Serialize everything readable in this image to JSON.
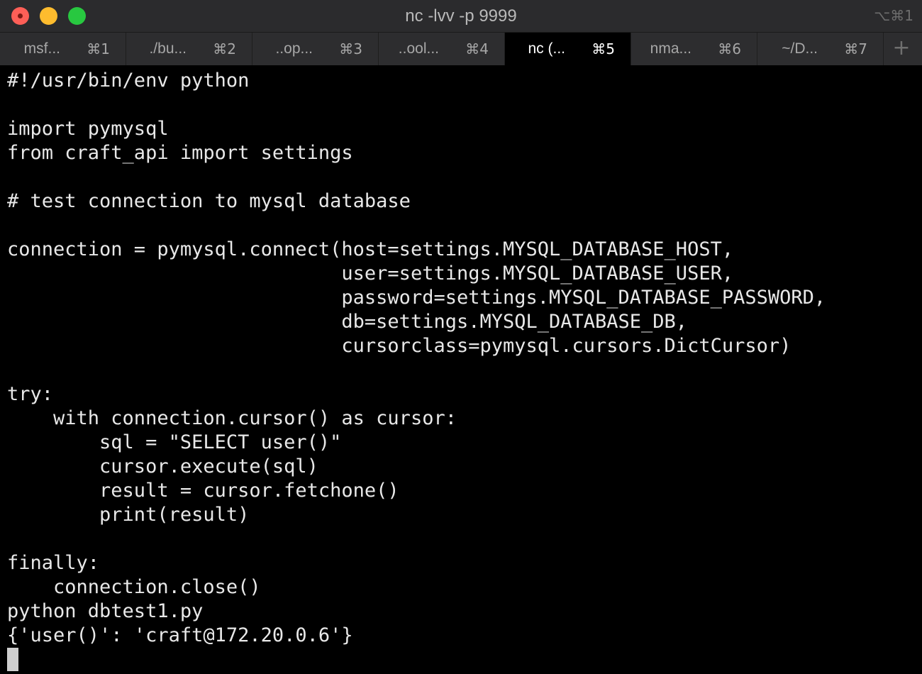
{
  "window": {
    "title": "nc -lvv -p 9999",
    "shortcut": "⌥⌘1"
  },
  "tabs": [
    {
      "title": "msf...",
      "key": "⌘1",
      "active": false
    },
    {
      "title": "./bu...",
      "key": "⌘2",
      "active": false
    },
    {
      "title": "..op...",
      "key": "⌘3",
      "active": false
    },
    {
      "title": "..ool...",
      "key": "⌘4",
      "active": false
    },
    {
      "title": "nc (...",
      "key": "⌘5",
      "active": true
    },
    {
      "title": "nma...",
      "key": "⌘6",
      "active": false
    },
    {
      "title": "~/D...",
      "key": "⌘7",
      "active": false
    }
  ],
  "tab_add_label": "+",
  "terminal": {
    "lines": [
      "#!/usr/bin/env python",
      "",
      "import pymysql",
      "from craft_api import settings",
      "",
      "# test connection to mysql database",
      "",
      "connection = pymysql.connect(host=settings.MYSQL_DATABASE_HOST,",
      "                             user=settings.MYSQL_DATABASE_USER,",
      "                             password=settings.MYSQL_DATABASE_PASSWORD,",
      "                             db=settings.MYSQL_DATABASE_DB,",
      "                             cursorclass=pymysql.cursors.DictCursor)",
      "",
      "try:",
      "    with connection.cursor() as cursor:",
      "        sql = \"SELECT user()\"",
      "        cursor.execute(sql)",
      "        result = cursor.fetchone()",
      "        print(result)",
      "",
      "finally:",
      "    connection.close()",
      "python dbtest1.py",
      "{'user()': 'craft@172.20.0.6'}"
    ]
  }
}
